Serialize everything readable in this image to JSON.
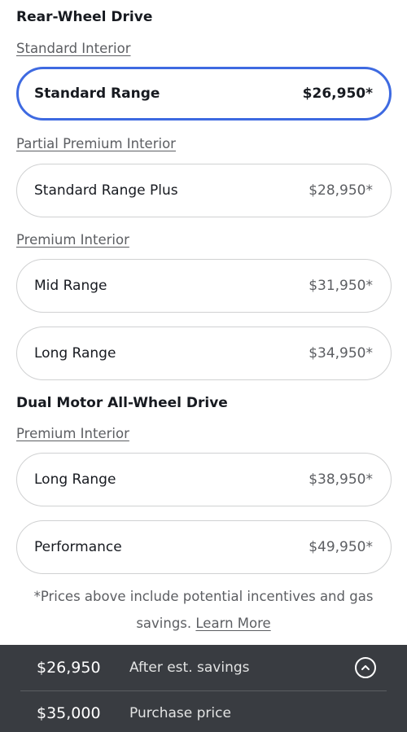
{
  "sections": {
    "rwd": {
      "title": "Rear-Wheel Drive",
      "standard_interior": "Standard Interior",
      "partial_premium_interior": "Partial Premium Interior",
      "premium_interior": "Premium Interior",
      "options": [
        {
          "name": "Standard Range",
          "price": "$26,950*",
          "selected": true
        },
        {
          "name": "Standard Range Plus",
          "price": "$28,950*",
          "selected": false
        },
        {
          "name": "Mid Range",
          "price": "$31,950*",
          "selected": false
        },
        {
          "name": "Long Range",
          "price": "$34,950*",
          "selected": false
        }
      ]
    },
    "awd": {
      "title": "Dual Motor All-Wheel Drive",
      "premium_interior": "Premium Interior",
      "options": [
        {
          "name": "Long Range",
          "price": "$38,950*",
          "selected": false
        },
        {
          "name": "Performance",
          "price": "$49,950*",
          "selected": false
        }
      ]
    }
  },
  "footnote": {
    "text": "*Prices above include potential incentives and gas savings.",
    "learn_more": "Learn More"
  },
  "price_bar": {
    "after_savings_amount": "$26,950",
    "after_savings_label": "After est. savings",
    "purchase_amount": "$35,000",
    "purchase_label": "Purchase price",
    "expand_icon": "chevron-up-circle-icon"
  },
  "colors": {
    "accent": "#3e6ae1",
    "bar_bg": "#393c41",
    "text": "#171a20",
    "muted": "#5c5e62"
  }
}
